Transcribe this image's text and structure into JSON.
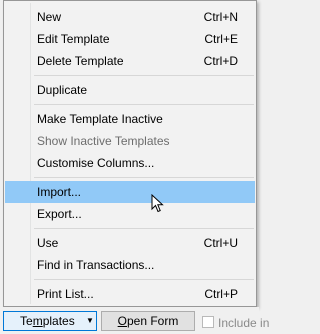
{
  "menu": {
    "items": [
      {
        "label": "New",
        "shortcut": "Ctrl+N"
      },
      {
        "label": "Edit Template",
        "shortcut": "Ctrl+E"
      },
      {
        "label": "Delete Template",
        "shortcut": "Ctrl+D"
      },
      {
        "label": "Duplicate",
        "shortcut": ""
      },
      {
        "label": "Make Template Inactive",
        "shortcut": ""
      },
      {
        "label": "Show Inactive Templates",
        "shortcut": "",
        "disabled": true
      },
      {
        "label": "Customise Columns...",
        "shortcut": ""
      },
      {
        "label": "Import...",
        "shortcut": "",
        "highlighted": true
      },
      {
        "label": "Export...",
        "shortcut": ""
      },
      {
        "label": "Use",
        "shortcut": "Ctrl+U"
      },
      {
        "label": "Find in Transactions...",
        "shortcut": ""
      },
      {
        "label": "Print List...",
        "shortcut": "Ctrl+P"
      }
    ]
  },
  "bottom_bar": {
    "templates_button": {
      "label_pre": "Te",
      "label_underlined": "m",
      "label_post": "plates",
      "dropdown_icon": "triangle-down-icon"
    },
    "open_form_button": {
      "label_underlined": "O",
      "label_post": "pen Form"
    },
    "include_checkbox": {
      "checked": false,
      "label": "Include in"
    }
  },
  "colors": {
    "highlight": "#91c9f7",
    "menu_bg": "#f2f2f2",
    "disabled_text": "#6d6d6d"
  },
  "cursor": {
    "icon": "arrow-cursor-icon"
  }
}
